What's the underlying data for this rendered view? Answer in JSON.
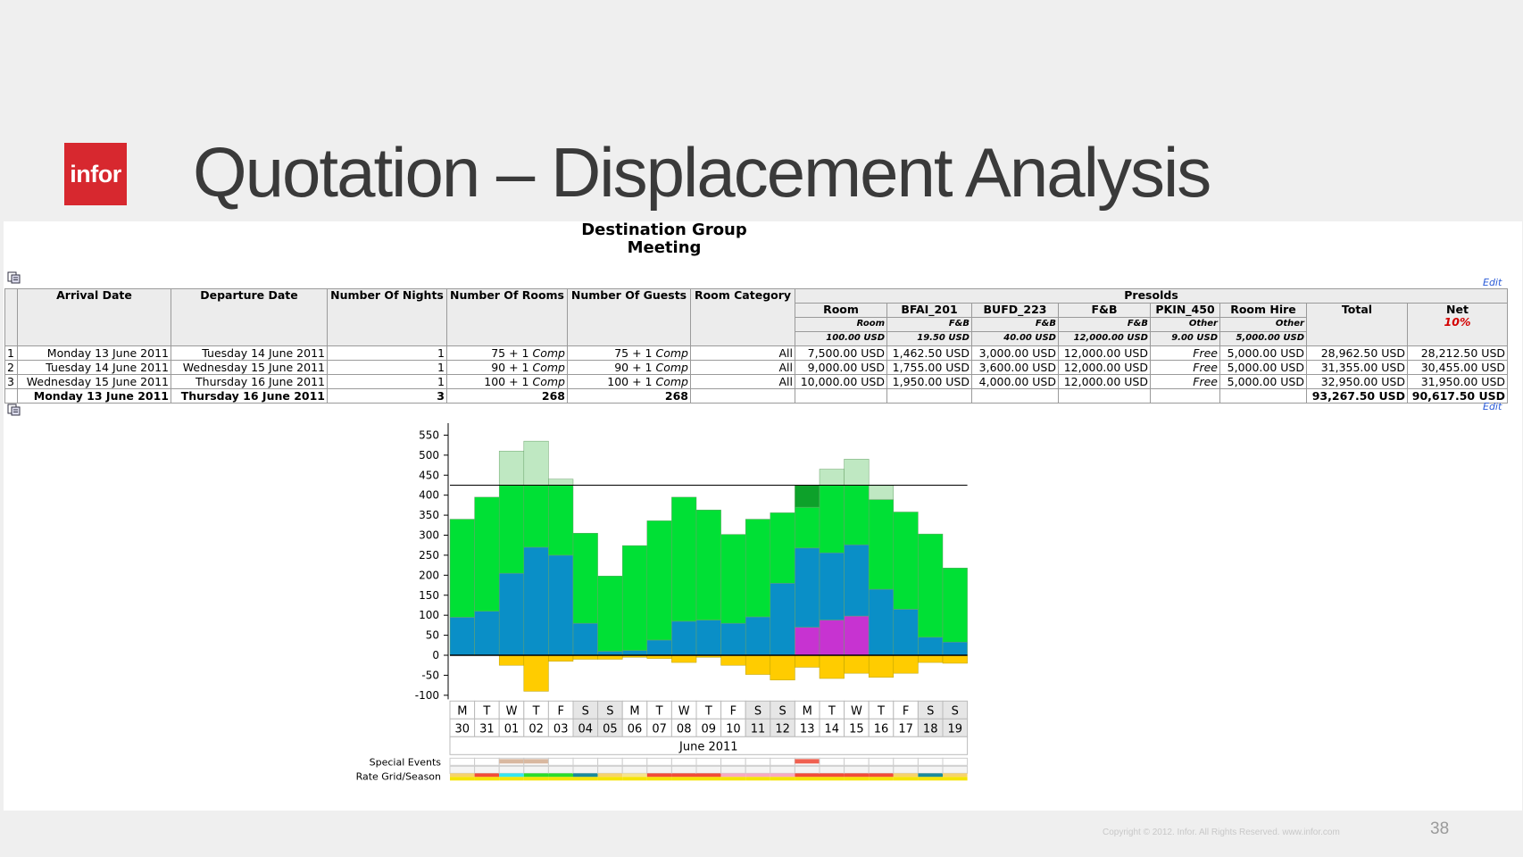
{
  "slide": {
    "logo_text": "infor",
    "title": "Quotation – Displacement Analysis",
    "copyright": "Copyright © 2012. Infor. All Rights Reserved. www.infor.com",
    "page_number": "38"
  },
  "quote": {
    "title_line1": "Destination Group",
    "title_line2": "Meeting",
    "edit_label": "Edit"
  },
  "table": {
    "headers": [
      "Arrival Date",
      "Departure Date",
      "Number Of Nights",
      "Number Of Rooms",
      "Number Of Guests",
      "Room Category",
      "Presolds",
      "Total",
      "Net"
    ],
    "presold_cols": [
      {
        "name": "Room",
        "category": "Room",
        "rate": "100.00 USD"
      },
      {
        "name": "BFAI_201",
        "category": "F&B",
        "rate": "19.50 USD"
      },
      {
        "name": "BUFD_223",
        "category": "F&B",
        "rate": "40.00 USD"
      },
      {
        "name": "F&B",
        "category": "F&B",
        "rate": "12,000.00 USD"
      },
      {
        "name": "PKIN_450",
        "category": "Other",
        "rate": "9.00 USD"
      },
      {
        "name": "Room Hire",
        "category": "Other",
        "rate": "5,000.00 USD"
      }
    ],
    "net_pct": "10%",
    "rows": [
      {
        "n": "1",
        "arrival": "Monday 13 June 2011",
        "departure": "Tuesday 14 June 2011",
        "nights": "1",
        "rooms": "75 + 1",
        "rooms_comp": "Comp",
        "guests": "75 + 1",
        "guests_comp": "Comp",
        "category": "All",
        "room": "7,500.00 USD",
        "bfai": "1,462.50 USD",
        "bufd": "3,000.00 USD",
        "fb": "12,000.00 USD",
        "pkin": "Free",
        "hire": "5,000.00 USD",
        "total": "28,962.50 USD",
        "net": "28,212.50 USD"
      },
      {
        "n": "2",
        "arrival": "Tuesday 14 June 2011",
        "departure": "Wednesday 15 June 2011",
        "nights": "1",
        "rooms": "90 + 1",
        "rooms_comp": "Comp",
        "guests": "90 + 1",
        "guests_comp": "Comp",
        "category": "All",
        "room": "9,000.00 USD",
        "bfai": "1,755.00 USD",
        "bufd": "3,600.00 USD",
        "fb": "12,000.00 USD",
        "pkin": "Free",
        "hire": "5,000.00 USD",
        "total": "31,355.00 USD",
        "net": "30,455.00 USD"
      },
      {
        "n": "3",
        "arrival": "Wednesday 15 June 2011",
        "departure": "Thursday 16 June 2011",
        "nights": "1",
        "rooms": "100 + 1",
        "rooms_comp": "Comp",
        "guests": "100 + 1",
        "guests_comp": "Comp",
        "category": "All",
        "room": "10,000.00 USD",
        "bfai": "1,950.00 USD",
        "bufd": "4,000.00 USD",
        "fb": "12,000.00 USD",
        "pkin": "Free",
        "hire": "5,000.00 USD",
        "total": "32,950.00 USD",
        "net": "31,950.00 USD"
      }
    ],
    "totals": {
      "arrival": "Monday 13 June 2011",
      "departure": "Thursday 16 June 2011",
      "nights": "3",
      "rooms": "268",
      "guests": "268",
      "total": "93,267.50 USD",
      "net": "90,617.50 USD"
    }
  },
  "chart_data": {
    "type": "bar",
    "days": [
      "M",
      "T",
      "W",
      "T",
      "F",
      "S",
      "S",
      "M",
      "T",
      "W",
      "T",
      "F",
      "S",
      "S",
      "M",
      "T",
      "W",
      "T",
      "F",
      "S",
      "S"
    ],
    "dates": [
      "30",
      "31",
      "01",
      "02",
      "03",
      "04",
      "05",
      "06",
      "07",
      "08",
      "09",
      "10",
      "11",
      "12",
      "13",
      "14",
      "15",
      "16",
      "17",
      "18",
      "19"
    ],
    "weekend": [
      false,
      false,
      false,
      false,
      false,
      true,
      true,
      false,
      false,
      false,
      false,
      false,
      true,
      true,
      false,
      false,
      false,
      false,
      false,
      true,
      true
    ],
    "month_label": "June 2011",
    "yticks": [
      550,
      500,
      450,
      400,
      350,
      300,
      250,
      200,
      150,
      100,
      50,
      0,
      -50,
      -100
    ],
    "ylim": [
      -110,
      580
    ],
    "capacity": 425,
    "colors": {
      "group": "#c733d1",
      "blue": "#0a8fc7",
      "green": "#00e035",
      "over_light": "#bfe8c2",
      "over_dark": "#0da12a",
      "neg": "#ffcc00"
    },
    "series": {
      "group": [
        0,
        0,
        0,
        0,
        0,
        0,
        0,
        0,
        0,
        0,
        0,
        0,
        0,
        0,
        70,
        88,
        98,
        0,
        0,
        0,
        0
      ],
      "blue": [
        95,
        110,
        205,
        270,
        250,
        80,
        10,
        12,
        38,
        85,
        88,
        80,
        96,
        180,
        198,
        168,
        178,
        165,
        115,
        45,
        33
      ],
      "green": [
        245,
        285,
        220,
        155,
        175,
        225,
        188,
        262,
        298,
        310,
        275,
        222,
        244,
        176,
        102,
        169,
        149,
        224,
        243,
        258,
        185
      ],
      "over_light": [
        0,
        0,
        85,
        110,
        15,
        0,
        0,
        0,
        0,
        0,
        0,
        0,
        0,
        0,
        0,
        40,
        65,
        35,
        0,
        0,
        0
      ],
      "over_dark": [
        0,
        0,
        0,
        0,
        0,
        0,
        0,
        0,
        0,
        0,
        0,
        0,
        0,
        0,
        55,
        0,
        0,
        0,
        0,
        0,
        0
      ],
      "neg": [
        0,
        0,
        -25,
        -90,
        -15,
        -10,
        -10,
        -5,
        -8,
        -18,
        -5,
        -25,
        -48,
        -62,
        -30,
        -58,
        -45,
        -55,
        -45,
        -18,
        -20
      ]
    },
    "row_labels": [
      "Special Events",
      "Rate Grid/Season"
    ],
    "special_events": [
      "",
      "",
      "#d9b8a0",
      "#d9b8a0",
      "",
      "",
      "",
      "",
      "",
      "",
      "",
      "",
      "",
      "",
      "#f06050",
      "",
      "",
      "",
      "",
      "",
      ""
    ],
    "rate_grid": [
      "#f7d36a",
      "#f24c38",
      "#35e6f0",
      "#2bdc2b",
      "#2bdc2b",
      "#1a8a9a",
      "#f7d36a",
      "#f7e38a",
      "#f24c38",
      "#f24c38",
      "#f24c38",
      "#f9a9c0",
      "#f9a9c0",
      "#f9a9c0",
      "#f24c38",
      "#f24c38",
      "#f24c38",
      "#f24c38",
      "#f7d36a",
      "#1a8a9a",
      "#f7d36a"
    ]
  }
}
